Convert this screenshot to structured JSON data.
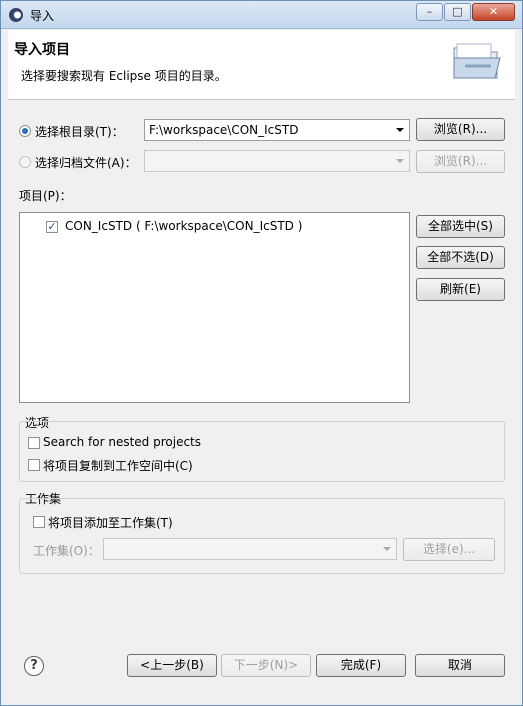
{
  "window": {
    "title": "导入",
    "controls": {
      "minimize": "–",
      "maximize": "□",
      "close": "✕"
    }
  },
  "header": {
    "title": "导入项目",
    "description": "选择要搜索现有 Eclipse 项目的目录。",
    "icon": "folder-icon"
  },
  "source": {
    "root_dir": {
      "label": "选择根目录(T)：",
      "value": "F:\\workspace\\CON_IcSTD",
      "selected": true
    },
    "archive": {
      "label": "选择归档文件(A)：",
      "value": "",
      "selected": false
    },
    "browse_label": "浏览(R)...",
    "browse_disabled_label": "浏览(R)..."
  },
  "projects": {
    "label": "项目(P)：",
    "items": [
      {
        "checked": true,
        "text": "CON_IcSTD ( F:\\workspace\\CON_IcSTD )"
      }
    ],
    "select_all": "全部选中(S)",
    "deselect_all": "全部不选(D)",
    "refresh": "刷新(E)"
  },
  "options": {
    "legend": "选项",
    "nested": {
      "label": "Search for nested projects",
      "checked": false
    },
    "copy": {
      "label": "将项目复制到工作空间中(C)",
      "checked": false
    }
  },
  "working_sets": {
    "legend": "工作集",
    "add": {
      "label": "将项目添加至工作集(T)",
      "checked": false
    },
    "sets_label": "工作集(O)：",
    "select_label": "选择(e)..."
  },
  "footer": {
    "help": "?",
    "back": "<上一步(B)",
    "next": "下一步(N)>",
    "finish": "完成(F)",
    "cancel": "取消"
  },
  "colors": {
    "accent": "#2a6fb7",
    "titlebar": "#c3d7ee",
    "close": "#c6432a"
  }
}
